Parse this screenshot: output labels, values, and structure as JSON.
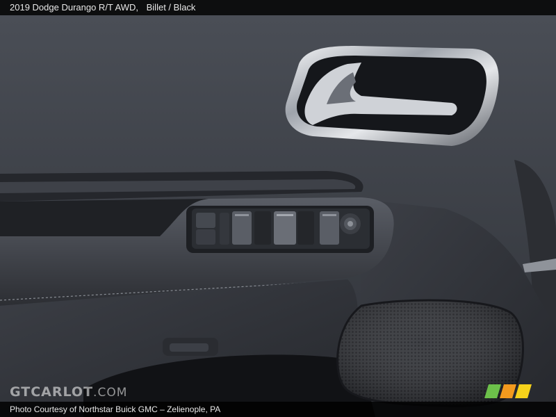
{
  "title": {
    "vehicle": "2019 Dodge Durango R/T AWD,",
    "trim": "Billet / Black"
  },
  "watermark": {
    "brand_prefix": "GTCARLOT",
    "brand_suffix": ".COM"
  },
  "credit": {
    "text": "Photo Courtesy of Northstar Buick GMC – Zelienople, PA"
  },
  "colors": {
    "door_panel": "#3a3d44",
    "chrome": "#c9ccd2",
    "logo_green": "#6cc04a",
    "logo_orange": "#f39a1e",
    "logo_yellow": "#f6d21b"
  },
  "icons": [
    "logo-stripes-icon"
  ]
}
